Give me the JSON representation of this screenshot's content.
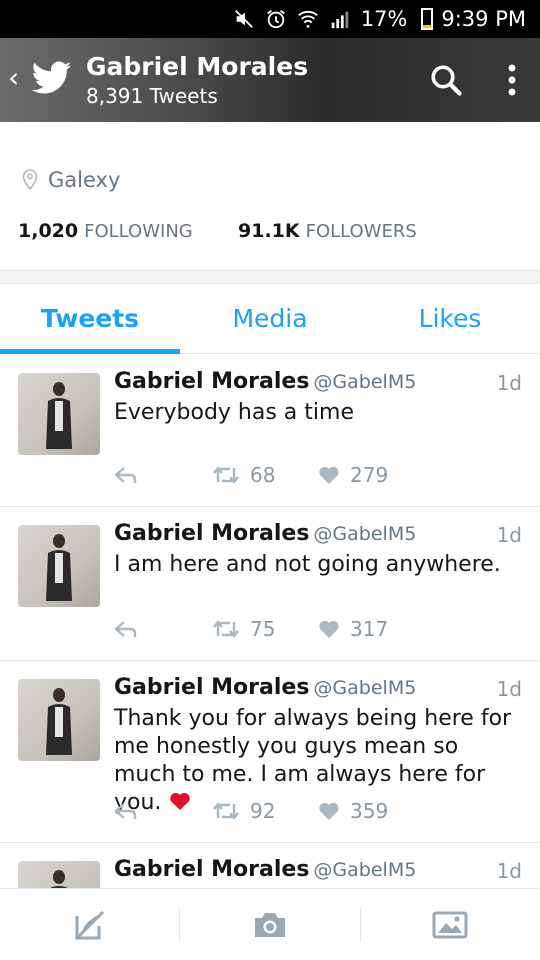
{
  "status_bar": {
    "battery": "17%",
    "time": "9:39 PM",
    "icons": [
      "mute-icon",
      "alarm-icon",
      "wifi-icon",
      "signal-icon",
      "battery-icon"
    ]
  },
  "header": {
    "title": "Gabriel Morales",
    "subtitle": "8,391 Tweets",
    "icons": [
      "back-icon",
      "twitter-bird-icon",
      "search-icon",
      "more-vertical-icon"
    ]
  },
  "profile": {
    "location": "Galexy",
    "following_count": "1,020",
    "following_label": "FOLLOWING",
    "followers_count": "91.1K",
    "followers_label": "FOLLOWERS"
  },
  "tabs": [
    {
      "label": "Tweets",
      "active": true
    },
    {
      "label": "Media",
      "active": false
    },
    {
      "label": "Likes",
      "active": false
    }
  ],
  "tweets": [
    {
      "name": "Gabriel Morales",
      "handle": "@GabelM5",
      "time": "1d",
      "text": "Everybody has a time",
      "retweets": "68",
      "likes": "279"
    },
    {
      "name": "Gabriel Morales",
      "handle": "@GabelM5",
      "time": "1d",
      "text": "I am here and not going anywhere.",
      "retweets": "75",
      "likes": "317"
    },
    {
      "name": "Gabriel Morales",
      "handle": "@GabelM5",
      "time": "1d",
      "text": "Thank you for always being here for me honestly you guys mean so much to me. I am always here for you.",
      "retweets": "92",
      "likes": "359"
    },
    {
      "name": "Gabriel Morales",
      "handle": "@GabelM5",
      "time": "1d"
    }
  ],
  "bottom_bar": [
    "compose-icon",
    "camera-icon",
    "gallery-icon"
  ],
  "colors": {
    "accent": "#1da1f2",
    "heart": "#e0245e",
    "muted": "#8899a6"
  }
}
